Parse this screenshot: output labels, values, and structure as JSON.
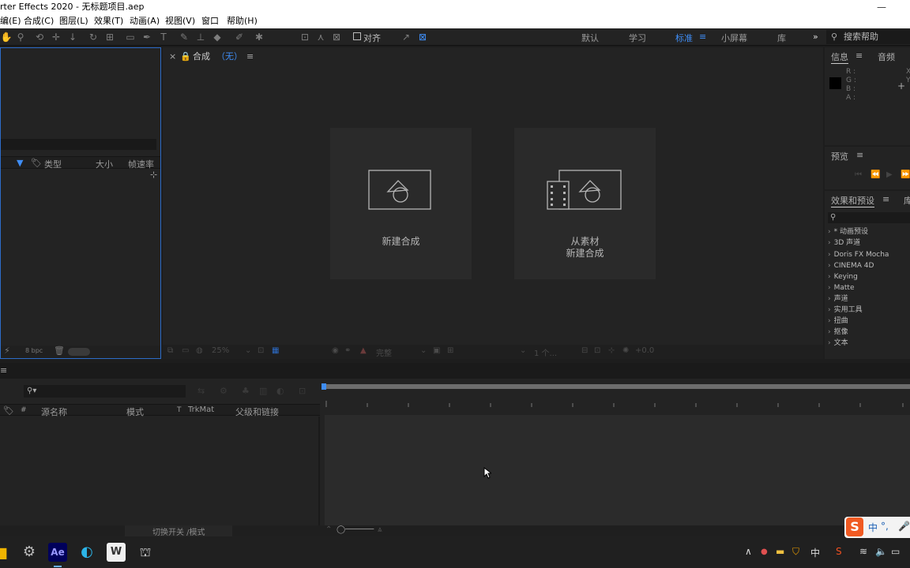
{
  "window": {
    "title": "rter Effects 2020 - 无标题项目.aep"
  },
  "menu": [
    "编(E)",
    "合成(C)",
    "图层(L)",
    "效果(T)",
    "动画(A)",
    "视图(V)",
    "窗口",
    "帮助(H)"
  ],
  "toolbar": {
    "snap_label": "对齐",
    "workspaces": [
      "默认",
      "学习",
      "标准",
      "小屏幕",
      "库"
    ],
    "active_workspace": "标准",
    "search_help_placeholder": "搜索帮助"
  },
  "project": {
    "columns": [
      "类型",
      "大小",
      "帧速率"
    ],
    "bpc": "8 bpc"
  },
  "viewer": {
    "tab_label": "合成",
    "tab_state": "（无）",
    "new_comp_label": "新建合成",
    "from_footage_line1": "从素材",
    "from_footage_line2": "新建合成",
    "zoom": "25%",
    "quality": "完整",
    "views": "1 个...",
    "exposure": "+0.0"
  },
  "info": {
    "tabs": [
      "信息",
      "音频"
    ],
    "channels": [
      "R :",
      "G :",
      "B :",
      "A :"
    ],
    "xy": [
      "X",
      "Y"
    ]
  },
  "preview": {
    "title": "预览"
  },
  "effects": {
    "title": "效果和预设",
    "items": [
      "* 动画预设",
      "3D 声道",
      "Doris FX Mocha",
      "CINEMA 4D",
      "Keying",
      "Matte",
      "声道",
      "实用工具",
      "扭曲",
      "抠像",
      "文本"
    ]
  },
  "timeline": {
    "columns": [
      "#",
      "源名称",
      "模式",
      "T",
      "TrkMat",
      "父级和链接"
    ],
    "toggle_label": "切换开关 /模式"
  },
  "taskbar": {
    "apps": [
      "folder",
      "settings",
      "Ae",
      "edge",
      "wps",
      "app"
    ],
    "ime_char": "中"
  },
  "ime": {
    "lang": "中"
  },
  "colors": {
    "accent": "#3f8ef7",
    "panel_bg": "#232323",
    "project_border": "#2d6cc8"
  }
}
